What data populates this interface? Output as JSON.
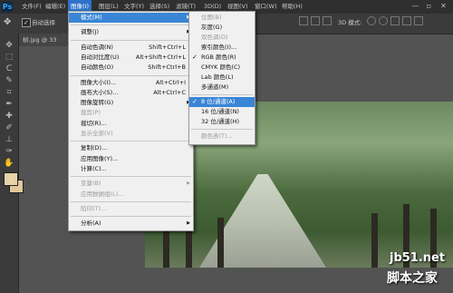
{
  "app": {
    "logo": "Ps"
  },
  "menubar": {
    "items": [
      "文件(F)",
      "编辑(E)",
      "图像(I)",
      "图层(L)",
      "文字(Y)",
      "选择(S)",
      "滤镜(T)",
      "3D(D)",
      "视图(V)",
      "窗口(W)",
      "帮助(H)"
    ],
    "window_buttons": [
      "—",
      "▫",
      "✕"
    ]
  },
  "options": {
    "auto_select_label": "自动选择",
    "mode_3d_label": "3D 模式:",
    "checkbox_mark": "✓"
  },
  "document": {
    "tab_title": "树.jpg @ 33"
  },
  "image_menu": {
    "items": [
      {
        "label": "模式(M)",
        "shortcut": "",
        "sub": true,
        "state": "hl"
      },
      {
        "sep": true
      },
      {
        "label": "调整(J)",
        "shortcut": "",
        "sub": true
      },
      {
        "sep": true
      },
      {
        "label": "自动色调(N)",
        "shortcut": "Shift+Ctrl+L"
      },
      {
        "label": "自动对比度(U)",
        "shortcut": "Alt+Shift+Ctrl+L"
      },
      {
        "label": "自动颜色(O)",
        "shortcut": "Shift+Ctrl+B"
      },
      {
        "sep": true
      },
      {
        "label": "图像大小(I)...",
        "shortcut": "Alt+Ctrl+I"
      },
      {
        "label": "画布大小(S)...",
        "shortcut": "Alt+Ctrl+C"
      },
      {
        "label": "图像旋转(G)",
        "shortcut": "",
        "sub": true
      },
      {
        "label": "裁剪(P)",
        "shortcut": "",
        "state": "dis"
      },
      {
        "label": "裁切(R)...",
        "shortcut": ""
      },
      {
        "label": "显示全部(V)",
        "shortcut": "",
        "state": "dis"
      },
      {
        "sep": true
      },
      {
        "label": "复制(D)...",
        "shortcut": ""
      },
      {
        "label": "应用图像(Y)...",
        "shortcut": ""
      },
      {
        "label": "计算(C)...",
        "shortcut": ""
      },
      {
        "sep": true
      },
      {
        "label": "变量(B)",
        "shortcut": "",
        "sub": true,
        "state": "dis"
      },
      {
        "label": "应用数据组(L)...",
        "shortcut": "",
        "state": "dis"
      },
      {
        "sep": true
      },
      {
        "label": "陷印(T)...",
        "shortcut": "",
        "state": "dis"
      },
      {
        "sep": true
      },
      {
        "label": "分析(A)",
        "shortcut": "",
        "sub": true
      }
    ]
  },
  "mode_submenu": {
    "items": [
      {
        "label": "位图(B)",
        "state": "dis"
      },
      {
        "label": "灰度(G)"
      },
      {
        "label": "双色调(D)",
        "state": "dis"
      },
      {
        "label": "索引颜色(I)..."
      },
      {
        "label": "RGB 颜色(R)",
        "check": "✓"
      },
      {
        "label": "CMYK 颜色(C)"
      },
      {
        "label": "Lab 颜色(L)"
      },
      {
        "label": "多通道(M)"
      },
      {
        "sep": true
      },
      {
        "label": "8 位/通道(A)",
        "check": "✓",
        "state": "hl"
      },
      {
        "label": "16 位/通道(N)"
      },
      {
        "label": "32 位/通道(H)"
      },
      {
        "sep": true
      },
      {
        "label": "颜色表(T)...",
        "state": "dis"
      }
    ]
  },
  "watermark": {
    "site": "jb51.net",
    "brand": "脚本之家"
  },
  "colors": {
    "highlight": "#3a86d6",
    "menubar": "#2f2f2f",
    "workspace": "#535353"
  }
}
